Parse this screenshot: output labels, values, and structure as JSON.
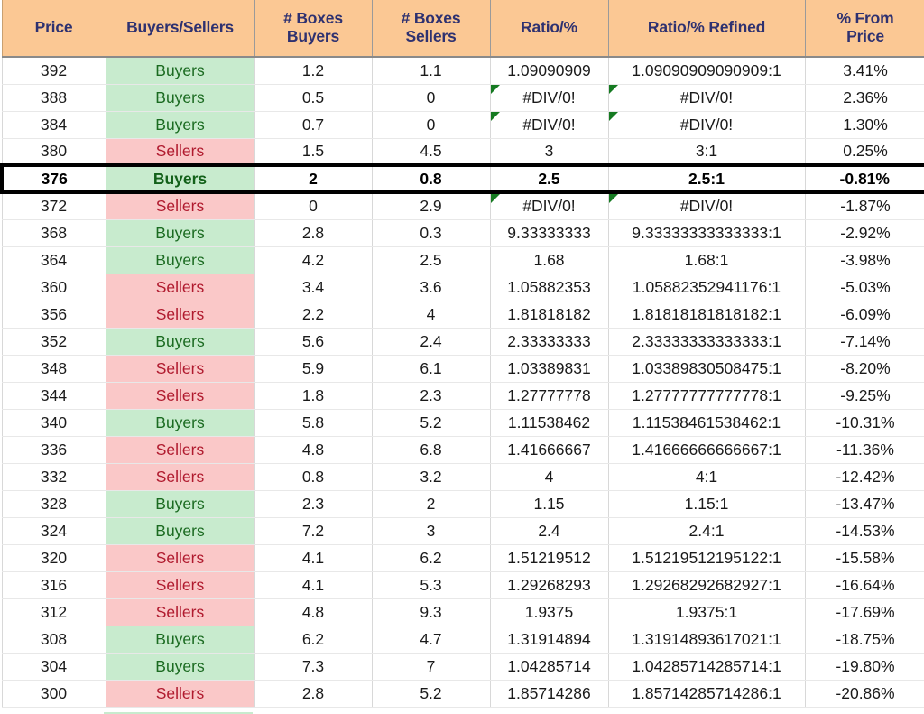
{
  "table": {
    "columns": [
      {
        "key": "price",
        "label_lines": [
          "Price"
        ]
      },
      {
        "key": "bs",
        "label_lines": [
          "Buyers/Sellers"
        ]
      },
      {
        "key": "boxes_b",
        "label_lines": [
          "# Boxes",
          "Buyers"
        ]
      },
      {
        "key": "boxes_s",
        "label_lines": [
          "# Boxes",
          "Sellers"
        ]
      },
      {
        "key": "ratio",
        "label_lines": [
          "Ratio/%"
        ]
      },
      {
        "key": "refined",
        "label_lines": [
          "Ratio/% Refined"
        ]
      },
      {
        "key": "pct",
        "label_lines": [
          "% From",
          "Price"
        ]
      }
    ],
    "header": {
      "price": "Price",
      "buyers_sellers": "Buyers/Sellers",
      "boxes_buyers_l1": "# Boxes",
      "boxes_buyers_l2": "Buyers",
      "boxes_sellers_l1": "# Boxes",
      "boxes_sellers_l2": "Sellers",
      "ratio": "Ratio/%",
      "ratio_refined": "Ratio/% Refined",
      "pct_from_price_l1": "% From",
      "pct_from_price_l2": "Price"
    },
    "colors": {
      "header_bg": "#fbc894",
      "header_text": "#2e3170",
      "buyers_bg": "#c8ebce",
      "buyers_text": "#1b6b21",
      "sellers_bg": "#fac8c8",
      "sellers_text": "#b01a2e",
      "error_triangle": "#157a21",
      "highlight_border": "#000000",
      "cell_text": "#1a1a1a",
      "grid_line": "#d8d8d8"
    },
    "rows": [
      {
        "price": "392",
        "bs": "Buyers",
        "side": "buyers",
        "boxes_b": "1.2",
        "boxes_s": "1.1",
        "ratio": "1.09090909",
        "ratio_err": false,
        "refined": "1.09090909090909:1",
        "refined_err": false,
        "pct": "3.41%",
        "highlight": false
      },
      {
        "price": "388",
        "bs": "Buyers",
        "side": "buyers",
        "boxes_b": "0.5",
        "boxes_s": "0",
        "ratio": "#DIV/0!",
        "ratio_err": true,
        "refined": "#DIV/0!",
        "refined_err": true,
        "pct": "2.36%",
        "highlight": false
      },
      {
        "price": "384",
        "bs": "Buyers",
        "side": "buyers",
        "boxes_b": "0.7",
        "boxes_s": "0",
        "ratio": "#DIV/0!",
        "ratio_err": true,
        "refined": "#DIV/0!",
        "refined_err": true,
        "pct": "1.30%",
        "highlight": false
      },
      {
        "price": "380",
        "bs": "Sellers",
        "side": "sellers",
        "boxes_b": "1.5",
        "boxes_s": "4.5",
        "ratio": "3",
        "ratio_err": false,
        "refined": "3:1",
        "refined_err": false,
        "pct": "0.25%",
        "highlight": false
      },
      {
        "price": "376",
        "bs": "Buyers",
        "side": "buyers",
        "boxes_b": "2",
        "boxes_s": "0.8",
        "ratio": "2.5",
        "ratio_err": false,
        "refined": "2.5:1",
        "refined_err": false,
        "pct": "-0.81%",
        "highlight": true
      },
      {
        "price": "372",
        "bs": "Sellers",
        "side": "sellers",
        "boxes_b": "0",
        "boxes_s": "2.9",
        "ratio": "#DIV/0!",
        "ratio_err": true,
        "refined": "#DIV/0!",
        "refined_err": true,
        "pct": "-1.87%",
        "highlight": false
      },
      {
        "price": "368",
        "bs": "Buyers",
        "side": "buyers",
        "boxes_b": "2.8",
        "boxes_s": "0.3",
        "ratio": "9.33333333",
        "ratio_err": false,
        "refined": "9.33333333333333:1",
        "refined_err": false,
        "pct": "-2.92%",
        "highlight": false
      },
      {
        "price": "364",
        "bs": "Buyers",
        "side": "buyers",
        "boxes_b": "4.2",
        "boxes_s": "2.5",
        "ratio": "1.68",
        "ratio_err": false,
        "refined": "1.68:1",
        "refined_err": false,
        "pct": "-3.98%",
        "highlight": false
      },
      {
        "price": "360",
        "bs": "Sellers",
        "side": "sellers",
        "boxes_b": "3.4",
        "boxes_s": "3.6",
        "ratio": "1.05882353",
        "ratio_err": false,
        "refined": "1.05882352941176:1",
        "refined_err": false,
        "pct": "-5.03%",
        "highlight": false
      },
      {
        "price": "356",
        "bs": "Sellers",
        "side": "sellers",
        "boxes_b": "2.2",
        "boxes_s": "4",
        "ratio": "1.81818182",
        "ratio_err": false,
        "refined": "1.81818181818182:1",
        "refined_err": false,
        "pct": "-6.09%",
        "highlight": false
      },
      {
        "price": "352",
        "bs": "Buyers",
        "side": "buyers",
        "boxes_b": "5.6",
        "boxes_s": "2.4",
        "ratio": "2.33333333",
        "ratio_err": false,
        "refined": "2.33333333333333:1",
        "refined_err": false,
        "pct": "-7.14%",
        "highlight": false
      },
      {
        "price": "348",
        "bs": "Sellers",
        "side": "sellers",
        "boxes_b": "5.9",
        "boxes_s": "6.1",
        "ratio": "1.03389831",
        "ratio_err": false,
        "refined": "1.03389830508475:1",
        "refined_err": false,
        "pct": "-8.20%",
        "highlight": false
      },
      {
        "price": "344",
        "bs": "Sellers",
        "side": "sellers",
        "boxes_b": "1.8",
        "boxes_s": "2.3",
        "ratio": "1.27777778",
        "ratio_err": false,
        "refined": "1.27777777777778:1",
        "refined_err": false,
        "pct": "-9.25%",
        "highlight": false
      },
      {
        "price": "340",
        "bs": "Buyers",
        "side": "buyers",
        "boxes_b": "5.8",
        "boxes_s": "5.2",
        "ratio": "1.11538462",
        "ratio_err": false,
        "refined": "1.11538461538462:1",
        "refined_err": false,
        "pct": "-10.31%",
        "highlight": false
      },
      {
        "price": "336",
        "bs": "Sellers",
        "side": "sellers",
        "boxes_b": "4.8",
        "boxes_s": "6.8",
        "ratio": "1.41666667",
        "ratio_err": false,
        "refined": "1.41666666666667:1",
        "refined_err": false,
        "pct": "-11.36%",
        "highlight": false
      },
      {
        "price": "332",
        "bs": "Sellers",
        "side": "sellers",
        "boxes_b": "0.8",
        "boxes_s": "3.2",
        "ratio": "4",
        "ratio_err": false,
        "refined": "4:1",
        "refined_err": false,
        "pct": "-12.42%",
        "highlight": false
      },
      {
        "price": "328",
        "bs": "Buyers",
        "side": "buyers",
        "boxes_b": "2.3",
        "boxes_s": "2",
        "ratio": "1.15",
        "ratio_err": false,
        "refined": "1.15:1",
        "refined_err": false,
        "pct": "-13.47%",
        "highlight": false
      },
      {
        "price": "324",
        "bs": "Buyers",
        "side": "buyers",
        "boxes_b": "7.2",
        "boxes_s": "3",
        "ratio": "2.4",
        "ratio_err": false,
        "refined": "2.4:1",
        "refined_err": false,
        "pct": "-14.53%",
        "highlight": false
      },
      {
        "price": "320",
        "bs": "Sellers",
        "side": "sellers",
        "boxes_b": "4.1",
        "boxes_s": "6.2",
        "ratio": "1.51219512",
        "ratio_err": false,
        "refined": "1.51219512195122:1",
        "refined_err": false,
        "pct": "-15.58%",
        "highlight": false
      },
      {
        "price": "316",
        "bs": "Sellers",
        "side": "sellers",
        "boxes_b": "4.1",
        "boxes_s": "5.3",
        "ratio": "1.29268293",
        "ratio_err": false,
        "refined": "1.29268292682927:1",
        "refined_err": false,
        "pct": "-16.64%",
        "highlight": false
      },
      {
        "price": "312",
        "bs": "Sellers",
        "side": "sellers",
        "boxes_b": "4.8",
        "boxes_s": "9.3",
        "ratio": "1.9375",
        "ratio_err": false,
        "refined": "1.9375:1",
        "refined_err": false,
        "pct": "-17.69%",
        "highlight": false
      },
      {
        "price": "308",
        "bs": "Buyers",
        "side": "buyers",
        "boxes_b": "6.2",
        "boxes_s": "4.7",
        "ratio": "1.31914894",
        "ratio_err": false,
        "refined": "1.31914893617021:1",
        "refined_err": false,
        "pct": "-18.75%",
        "highlight": false
      },
      {
        "price": "304",
        "bs": "Buyers",
        "side": "buyers",
        "boxes_b": "7.3",
        "boxes_s": "7",
        "ratio": "1.04285714",
        "ratio_err": false,
        "refined": "1.04285714285714:1",
        "refined_err": false,
        "pct": "-19.80%",
        "highlight": false
      },
      {
        "price": "300",
        "bs": "Sellers",
        "side": "sellers",
        "boxes_b": "2.8",
        "boxes_s": "5.2",
        "ratio": "1.85714286",
        "ratio_err": false,
        "refined": "1.85714285714286:1",
        "refined_err": false,
        "pct": "-20.86%",
        "highlight": false
      }
    ]
  }
}
